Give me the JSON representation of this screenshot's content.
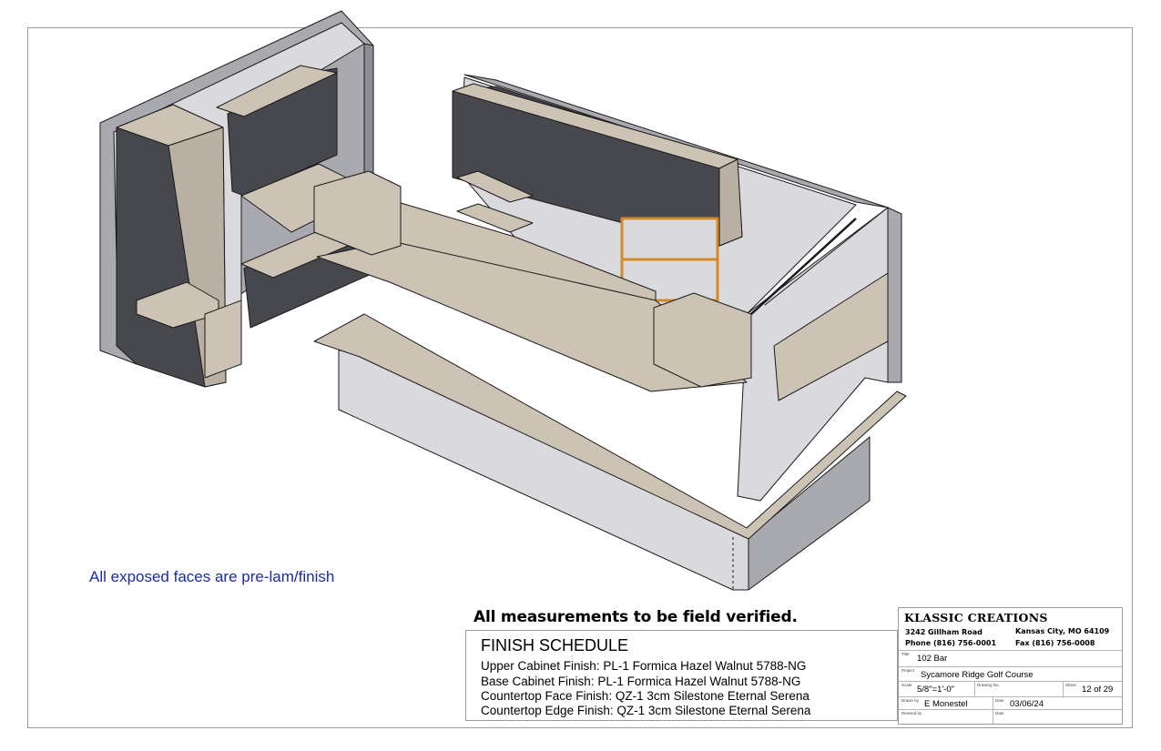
{
  "notes": {
    "exposed_faces": "All exposed faces are pre-lam/finish",
    "field_verify": "All measurements to be field verified."
  },
  "finish_schedule": {
    "title": "FINISH SCHEDULE",
    "rows": [
      "Upper Cabinet Finish: PL-1 Formica Hazel Walnut 5788-NG",
      "Base Cabinet Finish:  PL-1 Formica Hazel Walnut 5788-NG",
      "Countertop Face Finish:  QZ-1 3cm Silestone Eternal Serena",
      "Countertop Edge Finish:  QZ-1 3cm Silestone Eternal Serena"
    ]
  },
  "title_block": {
    "company": "KLASSIC CREATIONS",
    "address": "3242 Gillham Road",
    "city": "Kansas City, MO 64109",
    "phone": "Phone (816) 756-0001",
    "fax": "Fax (816) 756-0008",
    "title_caption": "Title",
    "title": "102 Bar",
    "project_caption": "Project",
    "project": "Sycamore Ridge Golf Course",
    "scale_caption": "Scale",
    "scale": "5/8\"=1'-0\"",
    "drawing_no_caption": "Drawing No.",
    "drawing_no": "",
    "sheet_caption": "Sheet",
    "sheet": "12 of 29",
    "drawn_by_caption": "Drawn by",
    "drawn_by": "E Monestel",
    "date_caption": "Date",
    "date": "03/06/24",
    "revised_by_caption": "Revised by",
    "revised_by": "",
    "revised_date_caption": "Date",
    "revised_date": ""
  },
  "colors": {
    "wall_light": "#d9d9de",
    "wall_side": "#a9a9b0",
    "cabinet_dark": "#47474e",
    "beige": "#cdc3b5",
    "beige_dark": "#a99e8f",
    "outline": "#1a1a1a",
    "accent_orange": "#d58a2a",
    "note_blue": "#1a2bb0"
  }
}
